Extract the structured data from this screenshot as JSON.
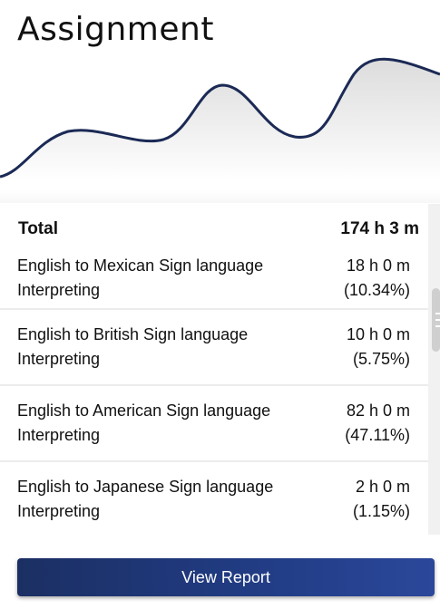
{
  "header": {
    "title": "Assignment"
  },
  "summary": {
    "total_label": "Total",
    "total_value": "174 h 3 m"
  },
  "items": [
    {
      "name": "English to Mexican Sign language Interpreting",
      "time": "18 h 0 m",
      "percent": "(10.34%)"
    },
    {
      "name": "English to British Sign language Interpreting",
      "time": "10 h 0 m",
      "percent": "(5.75%)"
    },
    {
      "name": "English to American Sign language Interpreting",
      "time": "82 h 0 m",
      "percent": "(47.11%)"
    },
    {
      "name": "English to Japanese Sign language Interpreting",
      "time": "2 h 0 m",
      "percent": "(1.15%)"
    }
  ],
  "actions": {
    "view_report_label": "View Report"
  },
  "colors": {
    "line": "#1b2a55",
    "button": "#223d86",
    "area_fill": "#e9e9e9"
  }
}
